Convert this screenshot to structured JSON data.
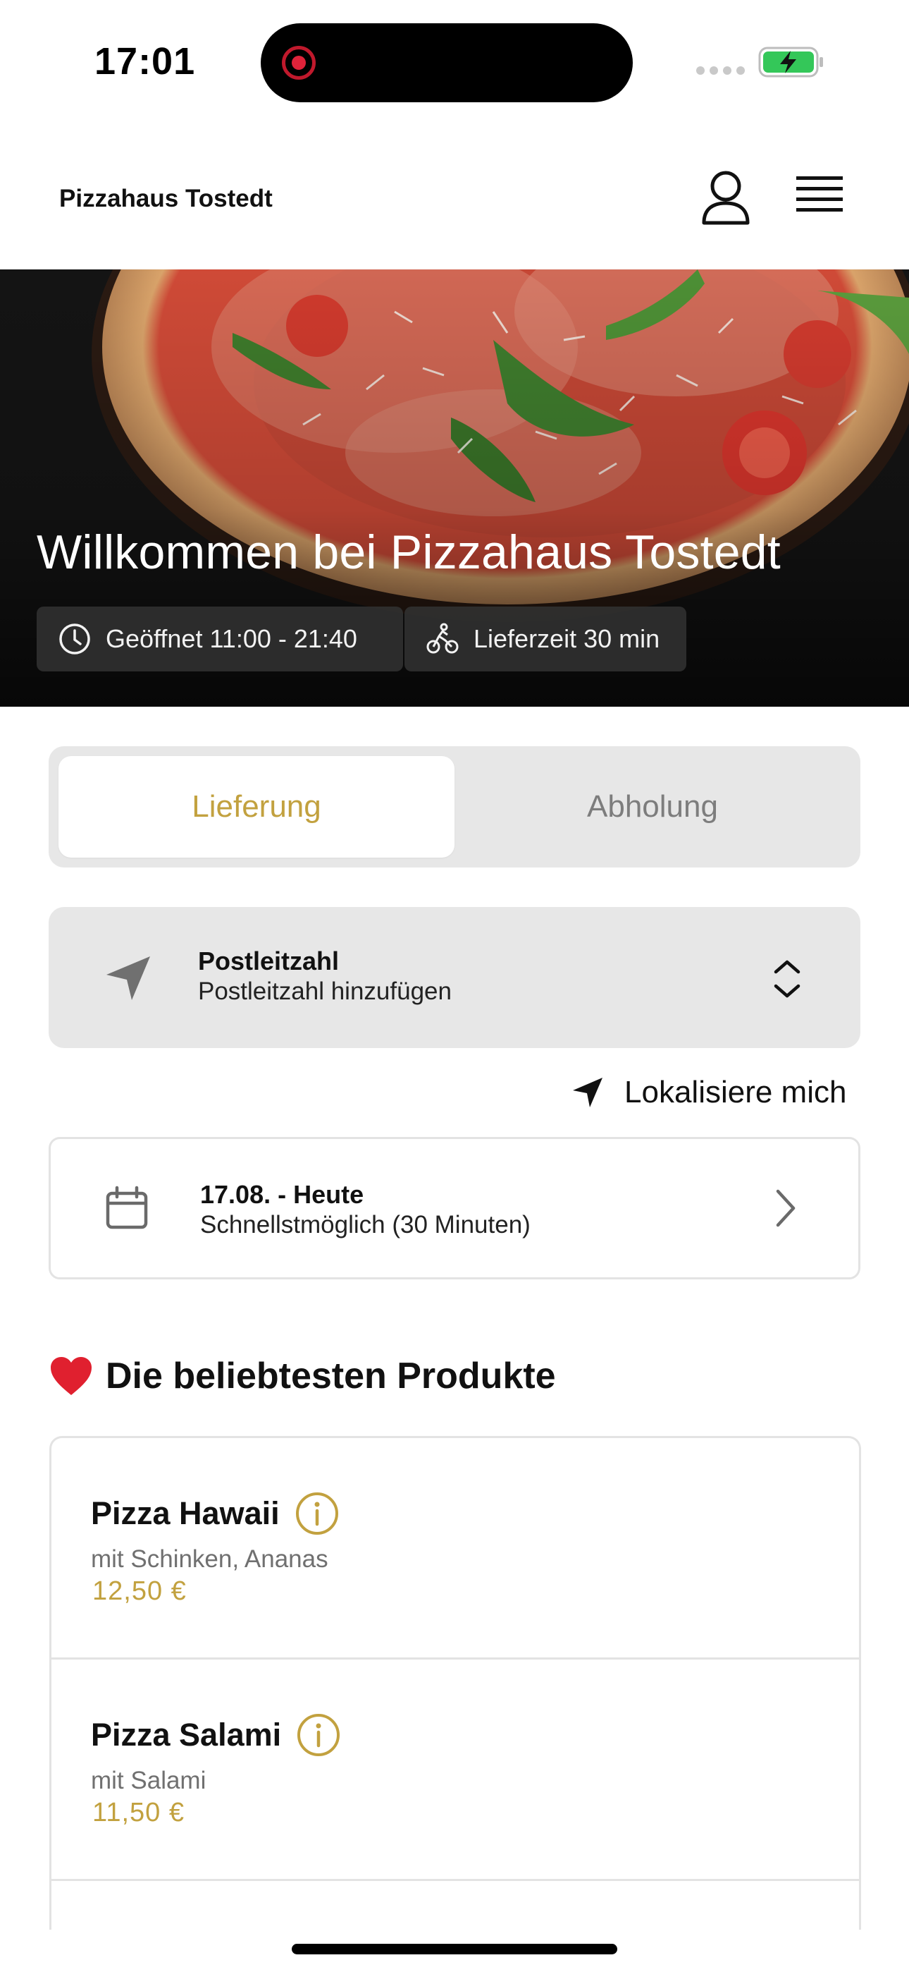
{
  "status_bar": {
    "time": "17:01"
  },
  "header": {
    "brand": "Pizzahaus Tostedt",
    "icons": [
      "user-icon",
      "menu-icon"
    ]
  },
  "hero": {
    "title": "Willkommen bei Pizzahaus Tostedt",
    "hours": "Geöffnet 11:00 - 21:40",
    "delivery_time": "Lieferzeit 30 min"
  },
  "order_mode": {
    "options": [
      "Lieferung",
      "Abholung"
    ],
    "selected": "Lieferung"
  },
  "postcode": {
    "title": "Postleitzahl",
    "placeholder": "Postleitzahl hinzufügen"
  },
  "locate": {
    "label": "Lokalisiere mich"
  },
  "date": {
    "title": "17.08. - Heute",
    "subtitle": "Schnellstmöglich (30 Minuten)"
  },
  "popular": {
    "emoji": "❤️",
    "title": "Die beliebtesten Produkte",
    "products": [
      {
        "name": "Pizza Hawaii",
        "description": "mit Schinken, Ananas",
        "price": "12,50 €"
      },
      {
        "name": "Pizza Salami",
        "description": "mit Salami",
        "price": "11,50 €"
      }
    ]
  },
  "colors": {
    "accent": "#c2a13f",
    "segment_bg": "#e7e7e7",
    "border": "#e3e3e3",
    "battery_green": "#34c759"
  }
}
